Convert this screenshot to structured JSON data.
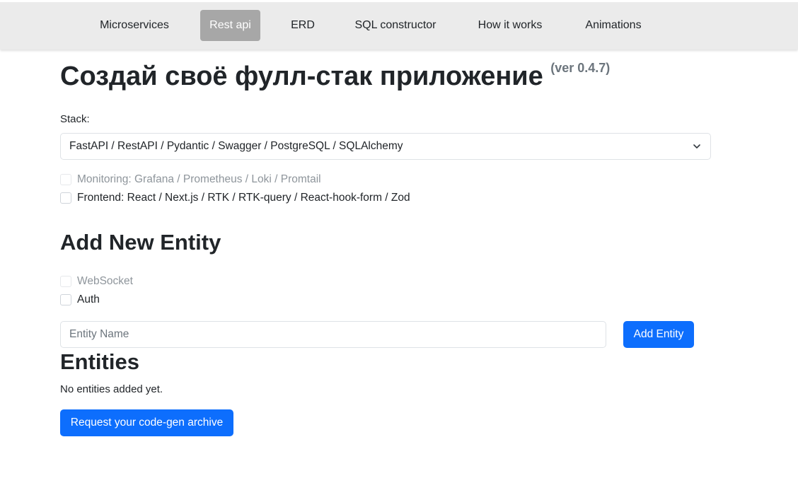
{
  "nav": {
    "items": [
      {
        "label": "Microservices"
      },
      {
        "label": "Rest api"
      },
      {
        "label": "ERD"
      },
      {
        "label": "SQL constructor"
      },
      {
        "label": "How it works"
      },
      {
        "label": "Animations"
      }
    ],
    "active_index": 1
  },
  "header": {
    "title": "Создай своё фулл-стак приложение",
    "version": "(ver 0.4.7)"
  },
  "stack": {
    "label": "Stack:",
    "selected": "FastAPI / RestAPI / Pydantic / Swagger / PostgreSQL / SQLAlchemy"
  },
  "options": {
    "monitoring": {
      "label": "Monitoring: Grafana / Prometheus / Loki / Promtail",
      "checked": false,
      "disabled": true
    },
    "frontend": {
      "label": "Frontend: React / Next.js / RTK / RTK-query / React-hook-form / Zod",
      "checked": false,
      "disabled": false
    }
  },
  "add_entity": {
    "heading": "Add New Entity",
    "websocket": {
      "label": "WebSocket",
      "checked": false,
      "disabled": true
    },
    "auth": {
      "label": "Auth",
      "checked": false,
      "disabled": false
    },
    "name_placeholder": "Entity Name",
    "button_label": "Add Entity"
  },
  "entities": {
    "heading": "Entities",
    "empty_text": "No entities added yet."
  },
  "request_button_label": "Request your code-gen archive",
  "colors": {
    "primary": "#0d6efd",
    "nav_bg": "#ebebeb",
    "nav_active_bg": "#a7a7a7",
    "muted": "#6c757d"
  },
  "icons": {
    "select_caret": "chevron-down-icon"
  }
}
